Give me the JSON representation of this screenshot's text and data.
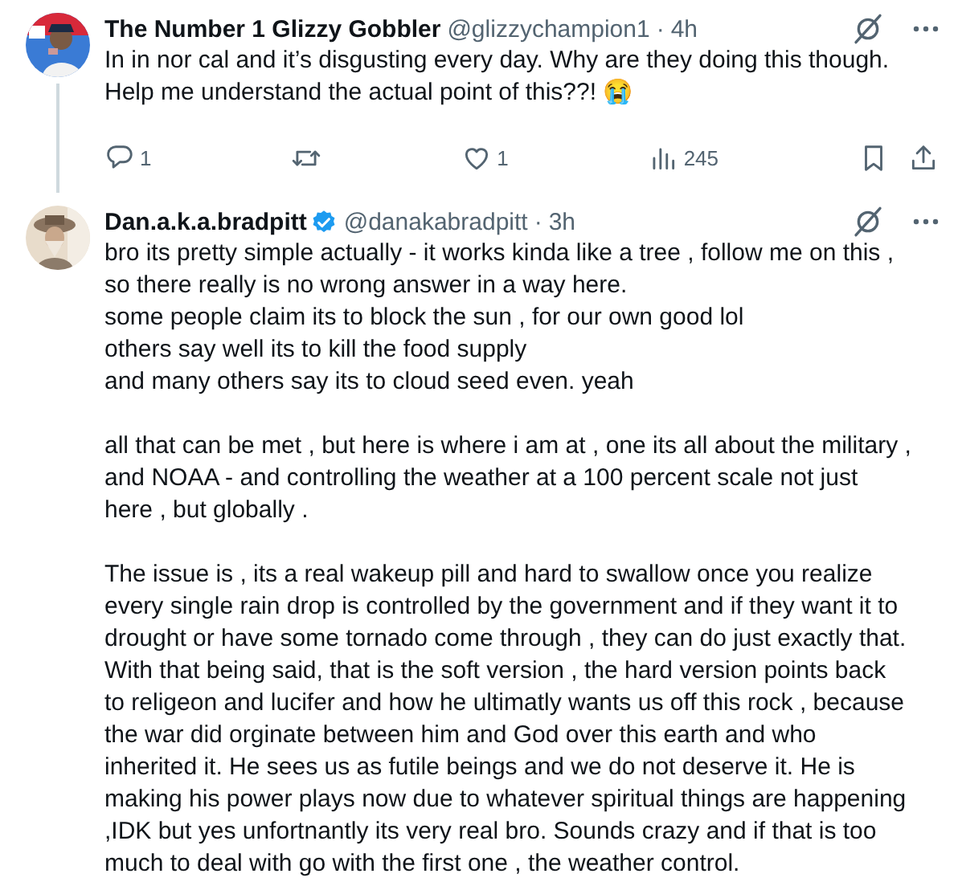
{
  "tweets": [
    {
      "display_name": "The Number 1 Glizzy Gobbler",
      "verified": false,
      "handle": "@glizzychampion1",
      "separator": "·",
      "time": "4h",
      "thread_line": true,
      "paragraphs": [
        [
          "In in nor cal and it’s disgusting every day. Why are they doing this though.",
          "Help me understand the actual point of this??! 😭"
        ]
      ],
      "actions": {
        "reply": "1",
        "like": "1",
        "views": "245"
      }
    },
    {
      "display_name": "Dan.a.k.a.bradpitt",
      "verified": true,
      "handle": "@danakabradpitt",
      "separator": "·",
      "time": "3h",
      "thread_line": false,
      "paragraphs": [
        [
          "bro its pretty simple actually - it works kinda like a tree , follow me on this ,",
          "so there really is no wrong answer in a way here.",
          "some people claim its to block the sun , for our own good lol",
          "others say well its to kill the food supply",
          "and many others say its to cloud seed even. yeah"
        ],
        [
          "all that can be met , but here is where i am at , one its all about the military ,",
          "and NOAA - and controlling the weather at a 100 percent scale not just",
          "here , but globally ."
        ],
        [
          "The issue is , its a real wakeup pill and hard to swallow once you realize",
          "every single rain drop is controlled by the government and if they want it to",
          "drought or have some tornado come through , they can do just exactly that.",
          "With that being said, that is the soft version , the hard version points back",
          "to religeon and lucifer and how he ultimatly wants us off this rock , because",
          "the war did orginate between him and God over this earth and who",
          "inherited it. He sees us as futile beings and we do not deserve it. He is",
          "making his power plays now due to whatever spiritual things are happening",
          ",IDK but yes unfortnantly its very real bro. Sounds crazy and if that is too",
          "much to deal with go with the first one , the weather control."
        ]
      ]
    }
  ]
}
